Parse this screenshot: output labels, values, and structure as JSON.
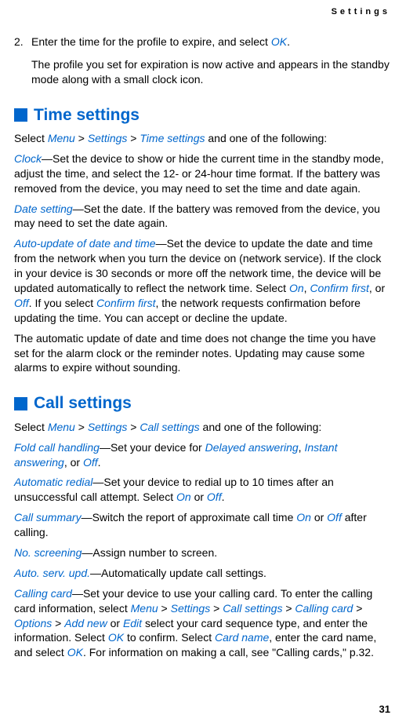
{
  "header": {
    "section_label": "Settings"
  },
  "step2": {
    "num": "2.",
    "line1_a": "Enter the time for the profile to expire, and select ",
    "ok": "OK",
    "period": ".",
    "follow": "The profile you set for expiration is now active and appears in the standby mode along with a small clock icon."
  },
  "time_settings": {
    "heading": "Time settings",
    "intro_a": "Select ",
    "menu": "Menu",
    "gt": " > ",
    "settings": "Settings",
    "time_settings": "Time settings",
    "intro_b": " and one of the following:",
    "clock_label": "Clock",
    "clock_body": "—Set the device to show or hide the current time in the standby mode, adjust the time, and select the 12- or 24-hour time format. If the battery was removed from the device, you may need to set the time and date again.",
    "date_label": "Date setting",
    "date_body": "—Set the date. If the battery was removed from the device, you may need to set the date again.",
    "auto_label": "Auto-update of date and time",
    "auto_body_a": "—Set the device to update the date and time from the network when you turn the device on (network service). If the clock in your device is 30 seconds or more off the network time, the device will be updated automatically to reflect the network time. Select ",
    "on": "On",
    "comma": ", ",
    "confirm_first": "Confirm first",
    "comma_or": ", or ",
    "off": "Off",
    "auto_body_b": ". If you select ",
    "auto_body_c": ", the network requests confirmation before updating the time. You can accept or decline the update.",
    "note": "The automatic update of date and time does not change the time you have set for the alarm clock or the reminder notes. Updating may cause some alarms to expire without sounding."
  },
  "call_settings": {
    "heading": "Call settings",
    "intro_a": "Select ",
    "menu": "Menu",
    "gt": " > ",
    "settings": "Settings",
    "call_settings": "Call settings",
    "intro_b": " and one of the following:",
    "fold_label": "Fold call handling",
    "fold_body_a": "—Set your device for ",
    "delayed": "Delayed answering",
    "comma": ", ",
    "instant": "Instant answering",
    "or": ", or ",
    "off": "Off",
    "period": ".",
    "redial_label": "Automatic redial",
    "redial_body_a": "—Set your device to redial up to 10 times after an unsuccessful call attempt. Select ",
    "on": "On",
    "or_word": " or ",
    "summary_label": "Call summary",
    "summary_body_a": "—Switch the report of approximate call time ",
    "summary_body_b": " after calling.",
    "no_screen_label": "No. screening",
    "no_screen_body": "—Assign number to screen.",
    "auto_serv_label": "Auto. serv. upd.",
    "auto_serv_body": "—Automatically update call settings.",
    "card_label": "Calling card",
    "card_body_a": "—Set your device to use your calling card. To enter the calling card information, select ",
    "calling_card": "Calling card",
    "options": "Options",
    "add_new": "Add new",
    "edit": "Edit",
    "card_body_b": " select your card sequence type, and enter the information. Select ",
    "ok": "OK",
    "card_body_c": " to confirm. Select ",
    "card_name": "Card name",
    "card_body_d": ", enter the card name, and select ",
    "card_body_e": ". For information on making a call, see \"Calling cards,\" p.32."
  },
  "page_number": "31"
}
